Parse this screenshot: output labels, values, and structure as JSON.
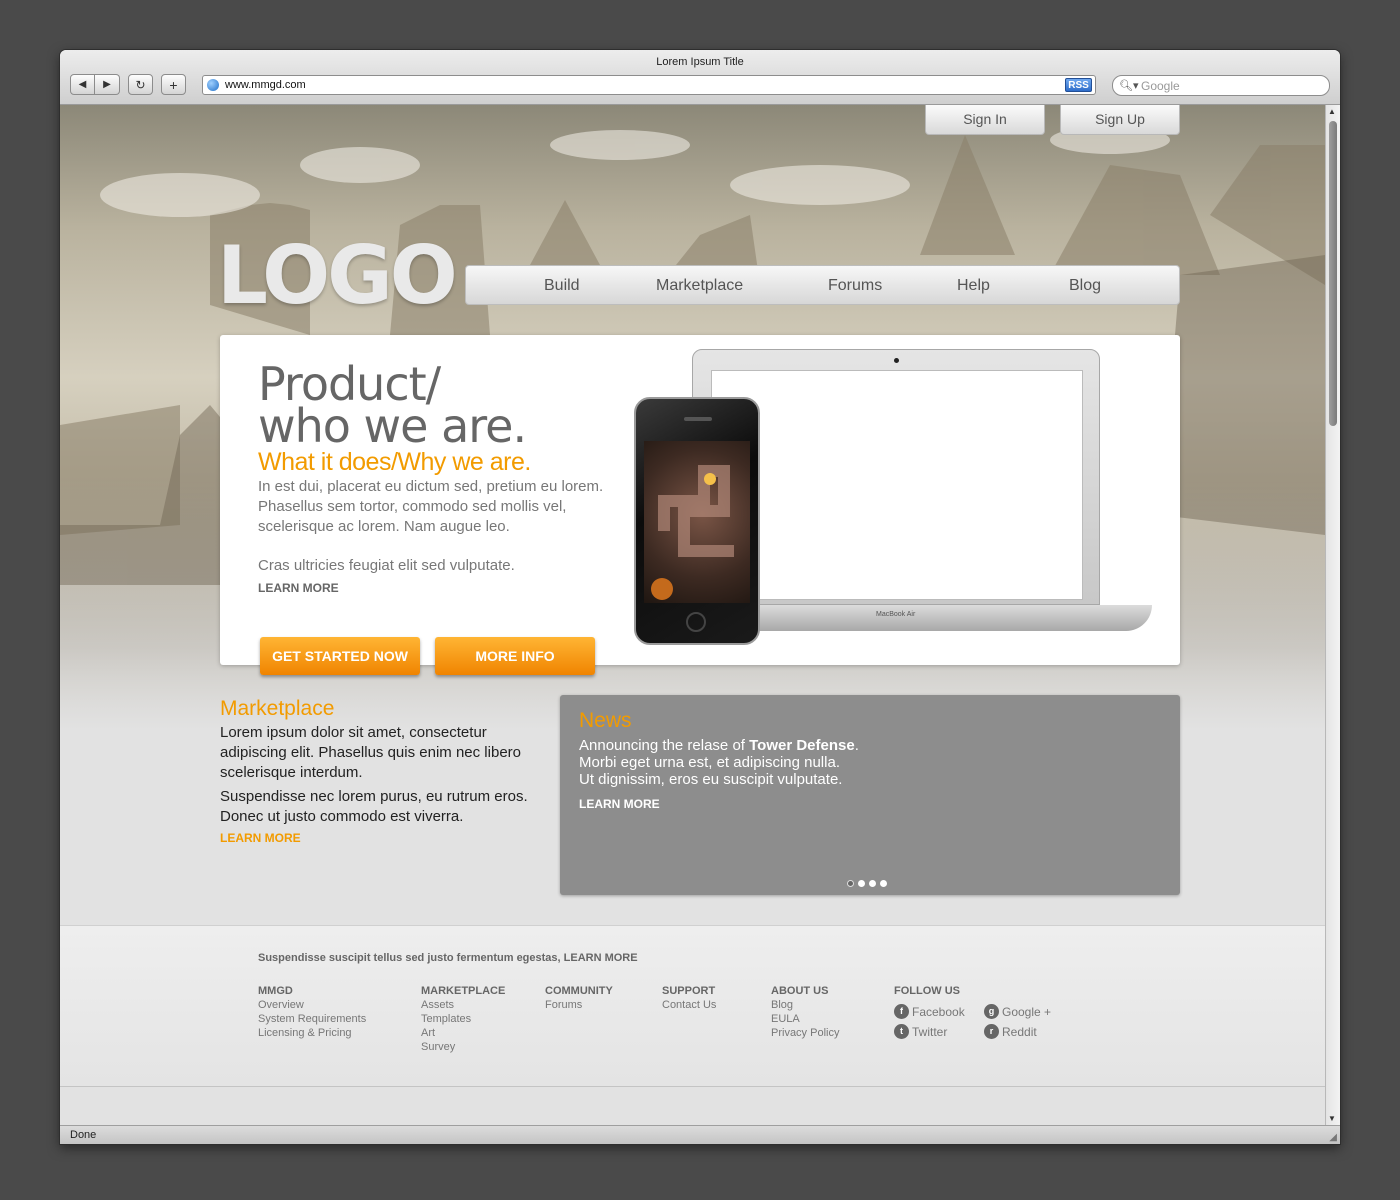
{
  "browser": {
    "title": "Lorem Ipsum Title",
    "url": "www.mmgd.com",
    "rss_label": "RSS",
    "search_placeholder": "Google",
    "status": "Done",
    "icons": {
      "back": "back-arrow-icon",
      "forward": "forward-arrow-icon",
      "reload": "reload-icon",
      "add": "add-tab-icon"
    }
  },
  "auth": {
    "sign_in": "Sign In",
    "sign_up": "Sign Up"
  },
  "logo": "LOGO",
  "nav": {
    "items": [
      "Build",
      "Marketplace",
      "Forums",
      "Help",
      "Blog"
    ]
  },
  "hero": {
    "headline_line1": "Product/",
    "headline_line2": "who we are.",
    "subhead": "What it does/Why we are.",
    "body": "In est dui, placerat eu dictum sed, pretium eu lorem. Phasellus sem tortor, commodo sed mollis vel, scelerisque ac lorem. Nam augue leo.",
    "body2": "Cras ultricies feugiat elit sed vulputate.",
    "learn_more": "LEARN MORE",
    "cta_primary": "GET STARTED NOW",
    "cta_secondary": "MORE INFO",
    "laptop_brand": "MacBook Air"
  },
  "marketplace": {
    "title": "Marketplace",
    "p1": "Lorem ipsum dolor sit amet, consectetur adipiscing elit. Phasellus quis enim nec libero scelerisque interdum.",
    "p2": "Suspendisse nec lorem purus, eu rutrum eros. Donec ut justo commodo est viverra.",
    "learn_more": "LEARN MORE"
  },
  "news": {
    "title": "News",
    "line1_prefix": "Announcing the relase of ",
    "line1_bold": "Tower Defense",
    "line1_suffix": ".",
    "line2": "Morbi eget urna est, et adipiscing nulla.",
    "line3": "Ut dignissim, eros eu suscipit vulputate.",
    "learn_more": "LEARN MORE",
    "slides_total": 4,
    "slide_active": 1
  },
  "footer": {
    "tagline": "Suspendisse suscipit tellus sed justo fermentum egestas, LEARN MORE",
    "columns": [
      {
        "heading": "MMGD",
        "links": [
          "Overview",
          "System Requirements",
          "Licensing & Pricing"
        ]
      },
      {
        "heading": "MARKETPLACE",
        "links": [
          "Assets",
          "Templates",
          "Art",
          "Survey"
        ]
      },
      {
        "heading": "COMMUNITY",
        "links": [
          "Forums"
        ]
      },
      {
        "heading": "SUPPORT",
        "links": [
          "Contact Us"
        ]
      },
      {
        "heading": "ABOUT US",
        "links": [
          "Blog",
          "EULA",
          "Privacy Policy"
        ]
      }
    ],
    "follow": {
      "heading": "FOLLOW US",
      "items": [
        {
          "label": "Facebook",
          "icon": "facebook-icon"
        },
        {
          "label": "Google +",
          "icon": "google-plus-icon"
        },
        {
          "label": "Twitter",
          "icon": "twitter-icon"
        },
        {
          "label": "Reddit",
          "icon": "reddit-icon"
        }
      ]
    }
  },
  "colors": {
    "accent": "#f29b00",
    "news_bg": "#8d8d8d",
    "chrome": "#d8d8d8"
  }
}
